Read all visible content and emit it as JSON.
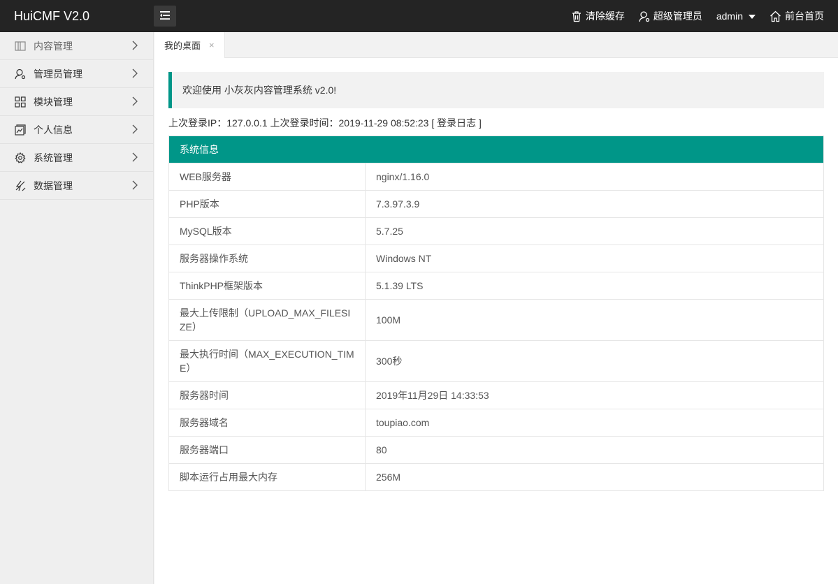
{
  "header": {
    "logo": "HuiCMF V2.0",
    "clear_cache": "清除缓存",
    "role": "超级管理员",
    "user": "admin",
    "home": "前台首页"
  },
  "sidebar": {
    "items": [
      {
        "label": "内容管理",
        "icon": "book-icon"
      },
      {
        "label": "管理员管理",
        "icon": "user-icon"
      },
      {
        "label": "模块管理",
        "icon": "grid-icon"
      },
      {
        "label": "个人信息",
        "icon": "chart-card-icon"
      },
      {
        "label": "系统管理",
        "icon": "gear-icon"
      },
      {
        "label": "数据管理",
        "icon": "data-icon"
      }
    ]
  },
  "tabs": [
    {
      "label": "我的桌面",
      "close": "×"
    }
  ],
  "welcome": "欢迎使用 小灰灰内容管理系统 v2.0!",
  "last_login": {
    "text": "上次登录IP：127.0.0.1 上次登录时间：2019-11-29 08:52:23",
    "log_link": "[ 登录日志 ]"
  },
  "sysinfo": {
    "title": "系统信息",
    "rows": [
      {
        "key": "WEB服务器",
        "value": "nginx/1.16.0"
      },
      {
        "key": "PHP版本",
        "value": "7.3.97.3.9"
      },
      {
        "key": "MySQL版本",
        "value": "5.7.25"
      },
      {
        "key": "服务器操作系统",
        "value": "Windows NT"
      },
      {
        "key": "ThinkPHP框架版本",
        "value": "5.1.39 LTS"
      },
      {
        "key": "最大上传限制（UPLOAD_MAX_FILESIZE）",
        "value": "100M"
      },
      {
        "key": "最大执行时间（MAX_EXECUTION_TIME）",
        "value": "300秒"
      },
      {
        "key": "服务器时间",
        "value": "2019年11月29日 14:33:53"
      },
      {
        "key": "服务器域名",
        "value": "toupiao.com"
      },
      {
        "key": "服务器端口",
        "value": "80"
      },
      {
        "key": "脚本运行占用最大内存",
        "value": "256M"
      }
    ]
  },
  "colors": {
    "header_bg": "#242424",
    "accent": "#009688"
  }
}
